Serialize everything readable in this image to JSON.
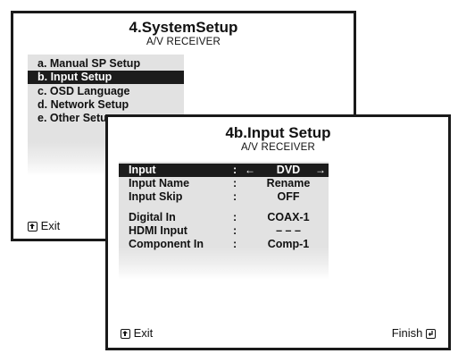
{
  "system_setup": {
    "title": "4.SystemSetup",
    "subtitle": "A/V RECEIVER",
    "menu": [
      {
        "label": "a. Manual SP Setup"
      },
      {
        "label": "b. Input Setup"
      },
      {
        "label": "c. OSD Language"
      },
      {
        "label": "d. Network Setup"
      },
      {
        "label": "e. Other Setup"
      }
    ],
    "selected_index": 1,
    "exit_label": "Exit"
  },
  "input_setup": {
    "title": "4b.Input Setup",
    "subtitle": "A/V RECEIVER",
    "rows": [
      {
        "label": "Input",
        "colon": ":",
        "value": "DVD"
      },
      {
        "label": "Input Name",
        "colon": ":",
        "value": "Rename"
      },
      {
        "label": "Input Skip",
        "colon": ":",
        "value": "OFF"
      },
      {
        "label": "Digital In",
        "colon": ":",
        "value": "COAX-1"
      },
      {
        "label": "HDMI Input",
        "colon": ":",
        "value": "– – –"
      },
      {
        "label": "Component In",
        "colon": ":",
        "value": "Comp-1"
      }
    ],
    "arrow_left": "←",
    "arrow_right": "→",
    "exit_label": "Exit",
    "finish_label": "Finish"
  },
  "icons": {
    "exit": "return-icon",
    "finish": "enter-icon"
  }
}
